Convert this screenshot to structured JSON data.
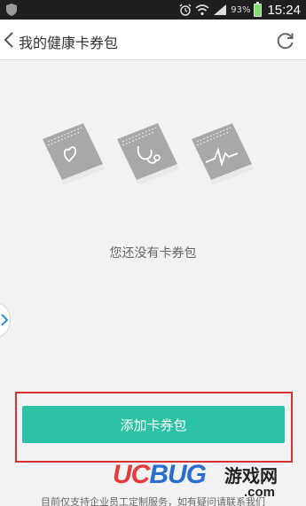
{
  "status_bar": {
    "battery_percent": "93%",
    "battery_level": 0.93,
    "time": "15:24"
  },
  "header": {
    "title": "我的健康卡券包"
  },
  "empty_state": {
    "message": "您还没有卡券包"
  },
  "actions": {
    "add_label": "添加卡券包"
  },
  "footer": {
    "note": "目前仅支持企业员工定制服务，如有疑问请联系我们"
  },
  "watermark": {
    "logo_uc": "UC",
    "logo_bug": "BUG",
    "site_name": "游戏网",
    "domain": ".com"
  },
  "colors": {
    "accent": "#2cc2a4",
    "highlight": "#d93030",
    "status_bar_bg": "#1f1f1f"
  }
}
